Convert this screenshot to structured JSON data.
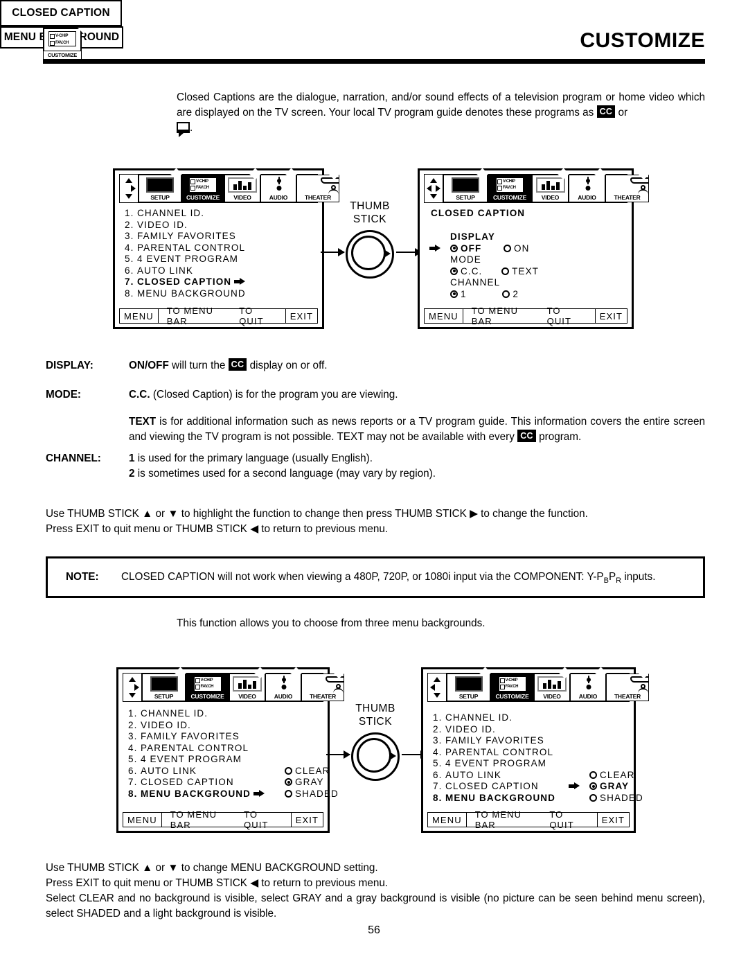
{
  "header": {
    "title": "CUSTOMIZE",
    "logo": {
      "line1": "V-CHIP",
      "line2": "FAV.CH",
      "caption": "CUSTOMIZE"
    }
  },
  "closed_caption": {
    "label": "CLOSED CAPTION",
    "intro_1": "Closed Captions are the dialogue, narration, and/or sound effects of a television program or home video which are displayed on the TV screen.  Your local TV program guide denotes these programs as",
    "intro_2": "or",
    "intro_3": "."
  },
  "menu_bar": {
    "tabs": [
      {
        "name": "SETUP",
        "icon": "tv-icon"
      },
      {
        "name": "CUSTOMIZE",
        "icon": "v-chip-icon"
      },
      {
        "name": "VIDEO",
        "icon": "video-bars-icon"
      },
      {
        "name": "AUDIO",
        "icon": "speaker-icon"
      },
      {
        "name": "THEATER",
        "icon": "theater-icon"
      }
    ],
    "selected": "CUSTOMIZE",
    "chip_text_1": "V-CHIP",
    "chip_text_2": "FAV.CH"
  },
  "footer": {
    "menu": "MENU",
    "to_menu_bar": "TO MENU BAR",
    "to_quit": "TO QUIT",
    "exit": "EXIT"
  },
  "customize_menu": {
    "items": [
      {
        "num": "1.",
        "label": "CHANNEL ID."
      },
      {
        "num": "2.",
        "label": "VIDEO ID."
      },
      {
        "num": "3.",
        "label": "FAMILY FAVORITES"
      },
      {
        "num": "4.",
        "label": "PARENTAL CONTROL"
      },
      {
        "num": "5.",
        "label": "4 EVENT PROGRAM"
      },
      {
        "num": "6.",
        "label": "AUTO LINK"
      },
      {
        "num": "7.",
        "label": "CLOSED CAPTION"
      },
      {
        "num": "8.",
        "label": "MENU BACKGROUND"
      }
    ]
  },
  "thumb_stick": {
    "line1": "THUMB",
    "line2": "STICK"
  },
  "cc_screen": {
    "title": "CLOSED CAPTION",
    "groups": [
      {
        "label": "DISPLAY",
        "options": [
          {
            "text": "OFF",
            "selected": true
          },
          {
            "text": "ON",
            "selected": false
          }
        ]
      },
      {
        "label": "MODE",
        "options": [
          {
            "text": "C.C.",
            "selected": true
          },
          {
            "text": "TEXT",
            "selected": false
          }
        ]
      },
      {
        "label": "CHANNEL",
        "options": [
          {
            "text": "1",
            "selected": true
          },
          {
            "text": "2",
            "selected": false
          }
        ]
      }
    ]
  },
  "descriptions": {
    "display_label": "DISPLAY:",
    "display_b": "ON/OFF",
    "display_t1": "will turn the",
    "display_t2": "display on or off.",
    "mode_label": "MODE:",
    "mode_b": "C.C.",
    "mode_t": "(Closed Caption) is for the program you are viewing.",
    "text_b": "TEXT",
    "text_t1": "is for additional information such as news reports or a TV program guide.  This information covers the entire screen and viewing the TV program is not possible.  TEXT may not be available with every",
    "text_t2": "program.",
    "channel_label": "CHANNEL:",
    "channel_1_b": "1",
    "channel_1_t": "is used for the primary language (usually English).",
    "channel_2_b": "2",
    "channel_2_t": "is sometimes used for a second language (may vary by region)."
  },
  "instructions_cc": {
    "line1": "Use THUMB STICK ▲ or ▼ to highlight the function to change then press THUMB STICK ▶ to change the function.",
    "line2": "Press EXIT to quit menu or THUMB STICK ◀ to return to previous menu."
  },
  "note": {
    "label": "NOTE:",
    "text_a": "CLOSED CAPTION will not work when viewing a 480P, 720P, or 1080i input via the COMPONENT: Y-P",
    "sub_b": "B",
    "text_b": "P",
    "sub_r": "R",
    "text_c": "inputs."
  },
  "menu_background": {
    "label": "MENU BACKGROUND",
    "description": "This function allows you to choose from three menu backgrounds.",
    "options": [
      {
        "text": "CLEAR",
        "selected": false
      },
      {
        "text": "GRAY",
        "selected": true
      },
      {
        "text": "SHADED",
        "selected": false
      }
    ]
  },
  "instructions_bg": {
    "line1": "Use THUMB STICK ▲ or ▼ to change MENU BACKGROUND setting.",
    "line2": "Press EXIT to quit menu or THUMB STICK ◀ to return to previous menu.",
    "line3": "Select CLEAR and no background is visible, select GRAY and a gray background is visible (no picture can be seen behind menu screen), select SHADED and a light background is visible."
  },
  "page_number": "56"
}
